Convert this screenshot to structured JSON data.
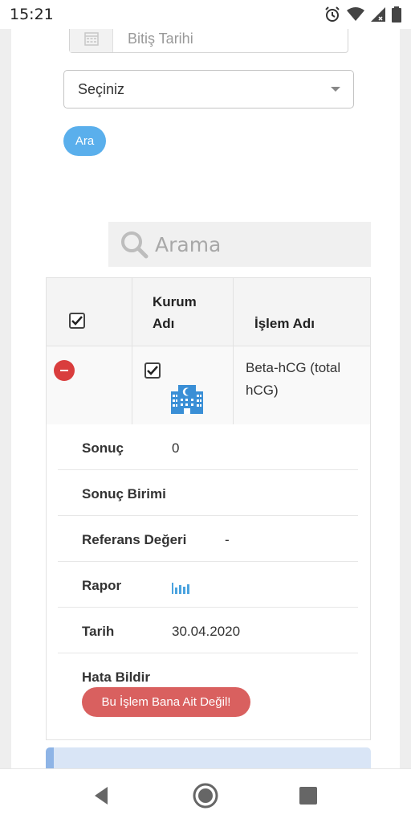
{
  "status_bar": {
    "time": "15:21"
  },
  "filters": {
    "end_date_placeholder": "Bitiş Tarihi",
    "select_value": "Seçiniz",
    "search_button_label": "Ara"
  },
  "search": {
    "placeholder": "Arama"
  },
  "table": {
    "columns": [
      "Kurum\nAdı",
      "İşlem Adı"
    ],
    "row": {
      "operation_name": "Beta-hCG (total hCG)",
      "checked": true
    },
    "details": [
      {
        "label": "Sonuç",
        "value": "0"
      },
      {
        "label": "Sonuç Birimi",
        "value": ""
      },
      {
        "label": "Referans Değeri",
        "value": "-"
      },
      {
        "label": "Rapor",
        "icon": "bar-chart-icon"
      },
      {
        "label": "Tarih",
        "value": "30.04.2020"
      },
      {
        "label": "Hata Bildir",
        "button_label": "Bu İşlem Bana Ait Değil!"
      }
    ]
  },
  "colors": {
    "primary": "#5aafec",
    "danger": "#d93d3d",
    "report_button": "#d9605f",
    "building_icon": "#3a8fd6"
  }
}
